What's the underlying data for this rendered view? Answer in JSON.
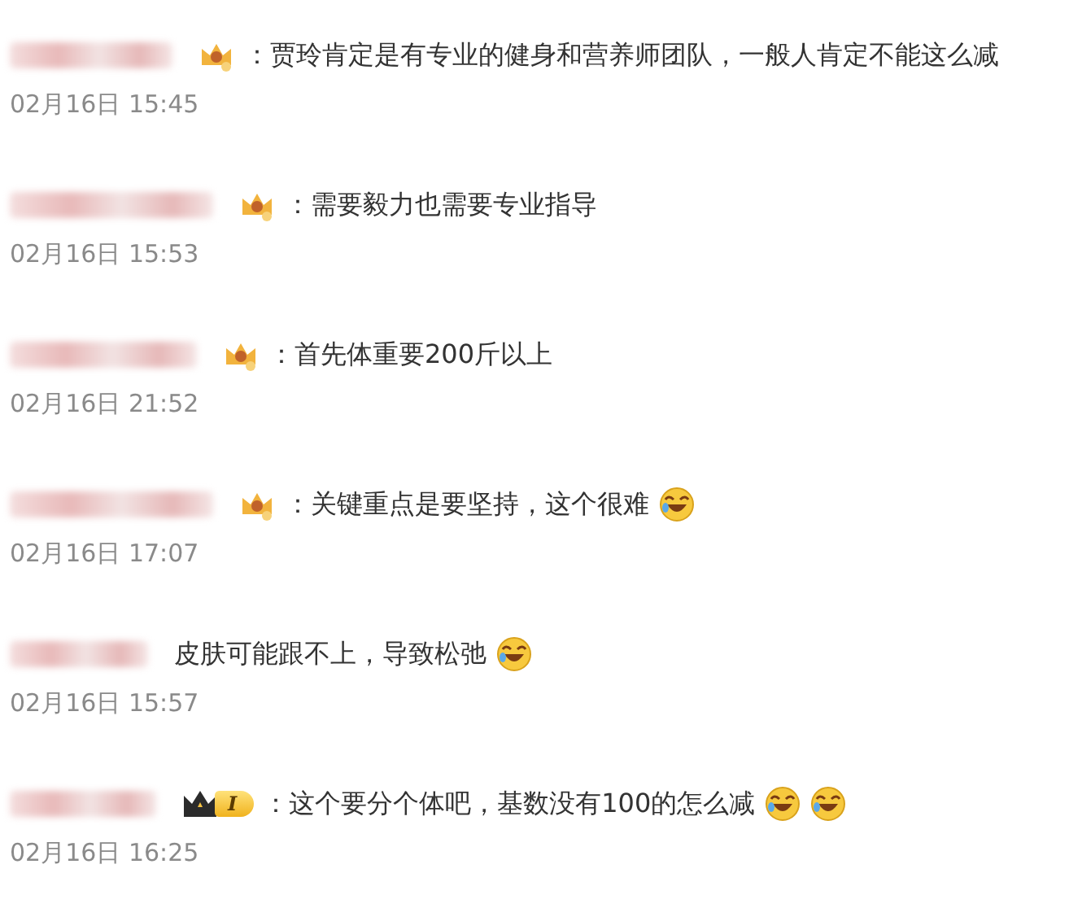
{
  "comments": [
    {
      "badge": {
        "kind": "crown"
      },
      "text": "：贾玲肯定是有专业的健身和营养师团队，一般人肯定不能这么减",
      "time": "02月16日 15:45"
    },
    {
      "badge": {
        "kind": "crown"
      },
      "text": "：需要毅力也需要专业指导",
      "time": "02月16日 15:53"
    },
    {
      "badge": {
        "kind": "crown"
      },
      "text": "：首先体重要200斤以上",
      "time": "02月16日 21:52"
    },
    {
      "badge": {
        "kind": "crown"
      },
      "text": "：关键重点是要坚持，这个很难",
      "emojis": [
        {
          "kind": "laugh-cry"
        }
      ],
      "time": "02月16日 17:07"
    },
    {
      "badge": {
        "kind": "none"
      },
      "text": "皮肤可能跟不上，导致松弛",
      "emojis": [
        {
          "kind": "laugh-cry"
        }
      ],
      "time": "02月16日 15:57"
    },
    {
      "badge": {
        "kind": "vip",
        "level": "I"
      },
      "text": "：这个要分个体吧，基数没有100的怎么减",
      "emojis": [
        {
          "kind": "laugh-cry"
        },
        {
          "kind": "laugh-cry"
        }
      ],
      "time": "02月16日 16:25"
    }
  ]
}
